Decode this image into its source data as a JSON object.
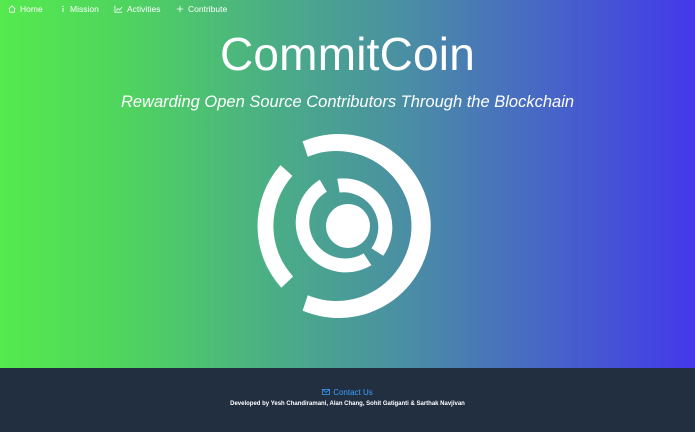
{
  "nav": {
    "items": [
      {
        "label": "Home",
        "icon": "home-icon"
      },
      {
        "label": "Mission",
        "icon": "info-icon"
      },
      {
        "label": "Activities",
        "icon": "chart-icon"
      },
      {
        "label": "Contribute",
        "icon": "plus-icon"
      }
    ]
  },
  "hero": {
    "title": "CommitCoin",
    "subtitle": "Rewarding Open Source Contributors Through the Blockchain",
    "logo_icon": "commitcoin-logo-icon"
  },
  "footer": {
    "contact_label": "Contact Us",
    "contact_icon": "mail-icon",
    "credits": "Developed by Yesh Chandiramani, Alan Chang, Sohit Gatiganti & Sarthak Navjivan"
  },
  "colors": {
    "gradient_start": "#55ea4e",
    "gradient_mid": "#4a98a0",
    "gradient_end": "#4338ea",
    "footer_bg": "#222f41",
    "link": "#3aa0ff"
  }
}
